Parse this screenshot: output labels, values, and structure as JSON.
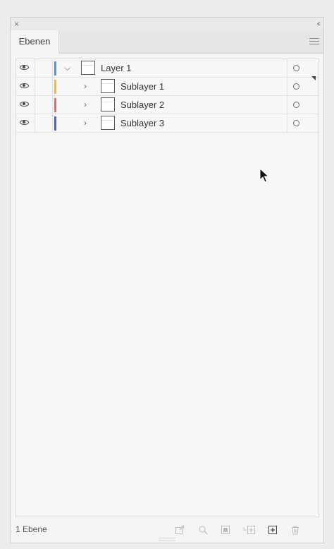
{
  "panel": {
    "tab_label": "Ebenen",
    "close_glyph": "×",
    "collapse_glyph": "‹‹"
  },
  "layers": [
    {
      "name": "Layer 1",
      "color": "#5b8ee6",
      "expanded": true,
      "visible": true
    },
    {
      "name": "Sublayer 1",
      "color": "#f2b552",
      "expanded": false,
      "visible": true
    },
    {
      "name": "Sublayer 2",
      "color": "#e06a6a",
      "expanded": false,
      "visible": true
    },
    {
      "name": "Sublayer 3",
      "color": "#4d5fd8",
      "expanded": false,
      "visible": true
    }
  ],
  "footer": {
    "count_label": "1 Ebene"
  },
  "icons": {
    "visibility": "eye-icon",
    "expand": "chevron-right-icon",
    "collapse": "chevron-down-icon",
    "target": "target-circle-icon",
    "panel_menu": "menu-icon",
    "footer": [
      "export-icon",
      "search-icon",
      "clipping-mask-icon",
      "new-sublayer-icon",
      "new-layer-icon",
      "trash-icon"
    ]
  }
}
